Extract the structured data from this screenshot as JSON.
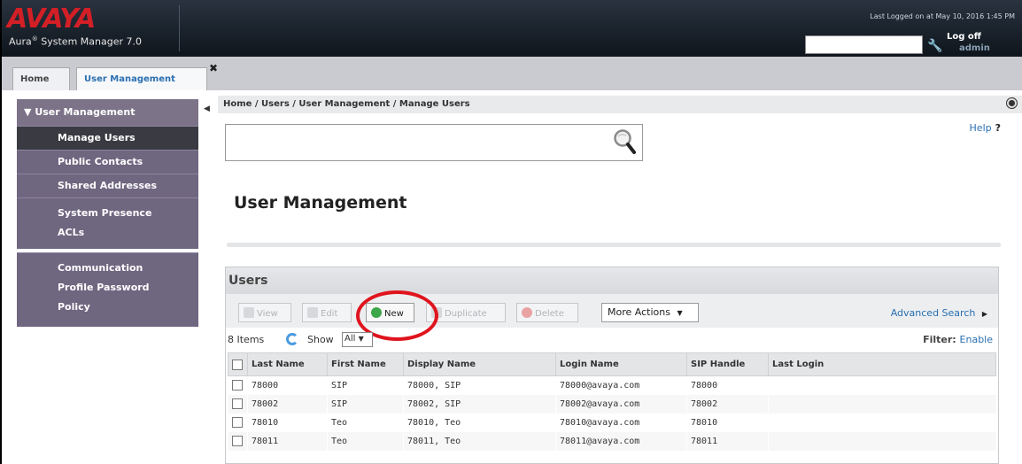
{
  "header": {
    "logo": "AVAYA",
    "product_prefix": "Aura",
    "product_name": "System Manager 7.0",
    "last_logged": "Last Logged on at May 10, 2016 1:45 PM",
    "logoff_label": "Log off",
    "user": "admin"
  },
  "tabs": [
    {
      "label": "Home"
    },
    {
      "label": "User Management"
    }
  ],
  "sidebar": {
    "section": "User Management",
    "items": [
      {
        "label": "Manage Users",
        "active": true
      },
      {
        "label": "Public Contacts"
      },
      {
        "label": "Shared Addresses"
      },
      {
        "label_lines": [
          "System Presence",
          "ACLs"
        ]
      },
      {
        "label_lines": [
          "Communication",
          "Profile Password",
          "Policy"
        ]
      }
    ]
  },
  "main": {
    "breadcrumb": "Home / Users / User Management / Manage Users",
    "help": "Help",
    "help_mark": "?",
    "title": "User Management"
  },
  "users_panel": {
    "title": "Users",
    "toolbar": {
      "view": "View",
      "edit": "Edit",
      "new": "New",
      "duplicate": "Duplicate",
      "delete": "Delete",
      "more_actions": "More Actions",
      "advanced_search": "Advanced Search"
    },
    "items_count": "8 Items",
    "show_label": "Show",
    "show_value": "All",
    "filter_label": "Filter:",
    "filter_link": "Enable",
    "columns": [
      "Last Name",
      "First Name",
      "Display Name",
      "Login Name",
      "SIP Handle",
      "Last Login"
    ],
    "rows": [
      [
        "78000",
        "SIP",
        "78000, SIP",
        "78000@avaya.com",
        "78000",
        ""
      ],
      [
        "78002",
        "SIP",
        "78002, SIP",
        "78002@avaya.com",
        "78002",
        ""
      ],
      [
        "78010",
        "Teo",
        "78010, Teo",
        "78010@avaya.com",
        "78010",
        ""
      ],
      [
        "78011",
        "Teo",
        "78011, Teo",
        "78011@avaya.com",
        "78011",
        ""
      ]
    ]
  },
  "colors": {
    "brand_red": "#d31f26",
    "nav_purple": "#6f6680",
    "link_blue": "#2a6fb0",
    "highlight_circle": "#e0141e"
  }
}
